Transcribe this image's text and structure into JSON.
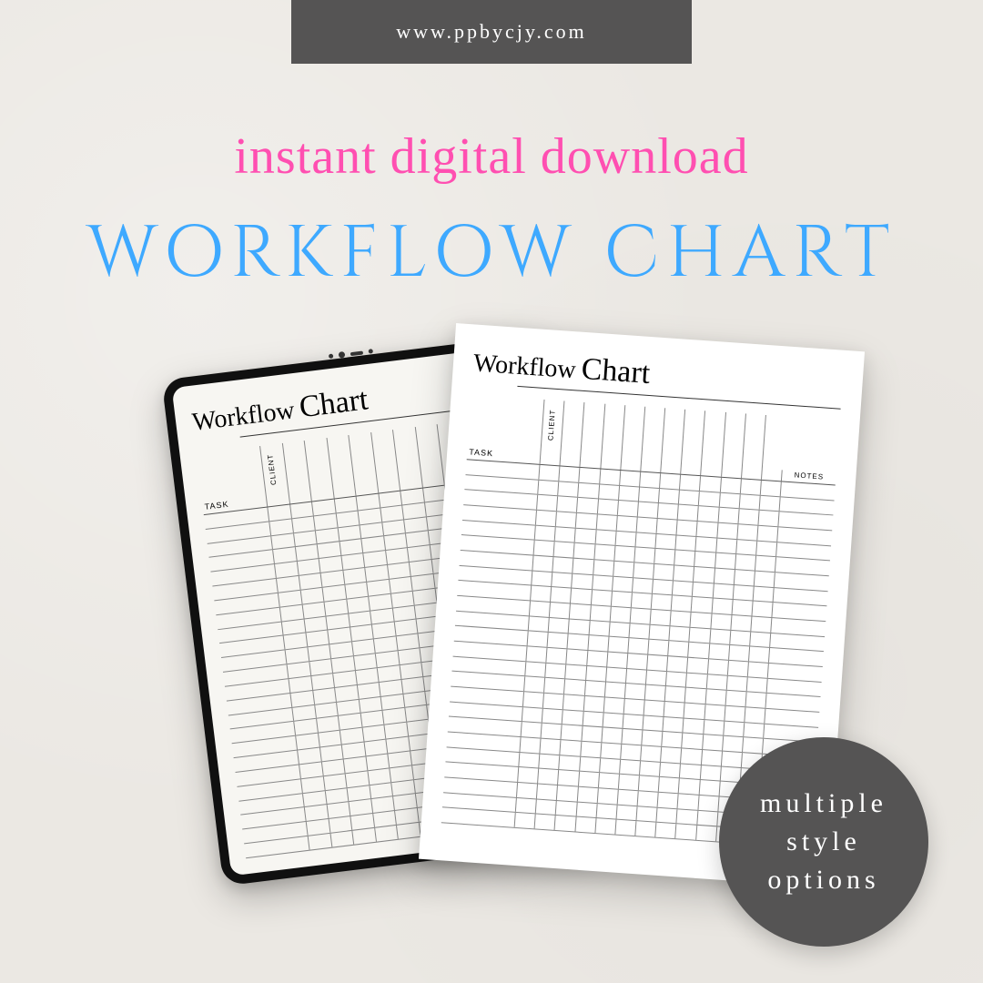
{
  "banner": {
    "url": "www.ppbycjy.com"
  },
  "header": {
    "subtitle": "instant digital download",
    "title": "WORKFLOW CHART"
  },
  "chart": {
    "title_word1": "Workflow",
    "title_word2": "Chart",
    "label_task": "TASK",
    "label_client": "CLIENT",
    "label_notes": "NOTES",
    "footer_url": "www.ppbycjy.com",
    "client_columns": 12,
    "body_rows": 24
  },
  "badge": {
    "line1": "multiple",
    "line2": "style",
    "line3": "options"
  },
  "colors": {
    "banner_bg": "#555454",
    "subtitle": "#ff4fb1",
    "title": "#3ea9ff",
    "badge_bg": "#555454"
  }
}
